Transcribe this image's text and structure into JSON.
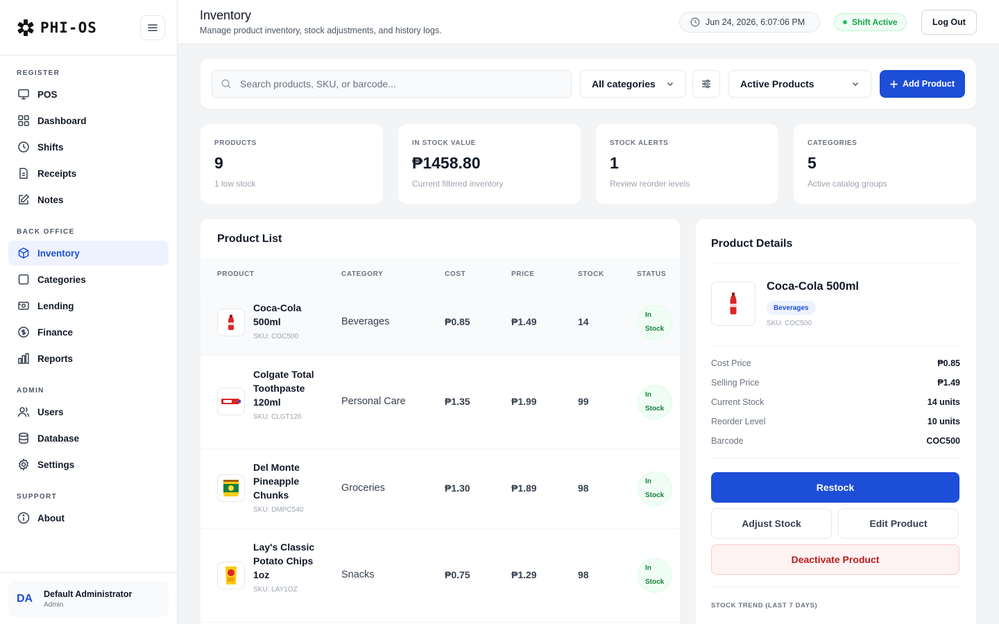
{
  "sidebar": {
    "brand": "PHI-OS",
    "sections": [
      {
        "title": "REGISTER",
        "items": [
          "POS",
          "Dashboard",
          "Shifts",
          "Receipts",
          "Notes"
        ]
      },
      {
        "title": "BACK OFFICE",
        "items": [
          "Inventory",
          "Categories",
          "Lending",
          "Finance",
          "Reports"
        ]
      },
      {
        "title": "ADMIN",
        "items": [
          "Users",
          "Database",
          "Settings"
        ]
      },
      {
        "title": "SUPPORT",
        "items": [
          "About"
        ]
      }
    ],
    "active_item": "Inventory",
    "user": {
      "initials": "DA",
      "name": "Default Administrator",
      "role": "Admin"
    }
  },
  "header": {
    "title": "Inventory",
    "subtitle": "Manage product inventory, stock adjustments, and history logs.",
    "datetime": "Jun 24, 2026, 6:07:06 PM",
    "shift_status": "Shift Active",
    "logout_label": "Log Out"
  },
  "filters": {
    "search_placeholder": "Search products, SKU, or barcode...",
    "category_select": "All categories",
    "status_select": "Active Products",
    "add_label": "Add Product"
  },
  "stats": [
    {
      "label": "PRODUCTS",
      "value": "9",
      "note": "1 low stock"
    },
    {
      "label": "IN STOCK VALUE",
      "value": "₱1458.80",
      "note": "Current filtered inventory"
    },
    {
      "label": "STOCK ALERTS",
      "value": "1",
      "note": "Review reorder levels"
    },
    {
      "label": "CATEGORIES",
      "value": "5",
      "note": "Active catalog groups"
    }
  ],
  "product_list": {
    "title": "Product List",
    "columns": [
      "PRODUCT",
      "CATEGORY",
      "COST",
      "PRICE",
      "STOCK",
      "STATUS"
    ],
    "rows": [
      {
        "name": "Coca-Cola 500ml",
        "sku": "SKU: COC500",
        "category": "Beverages",
        "cost": "₱0.85",
        "price": "₱1.49",
        "stock": "14",
        "status_line1": "In",
        "status_line2": "Stock",
        "thumb": "cola-bottle-icon"
      },
      {
        "name": "Colgate Total Toothpaste 120ml",
        "sku": "SKU: CLGT120",
        "category": "Personal Care",
        "cost": "₱1.35",
        "price": "₱1.99",
        "stock": "99",
        "status_line1": "In",
        "status_line2": "Stock",
        "thumb": "toothpaste-icon"
      },
      {
        "name": "Del Monte Pineapple Chunks",
        "sku": "SKU: DMPC540",
        "category": "Groceries",
        "cost": "₱1.30",
        "price": "₱1.89",
        "stock": "98",
        "status_line1": "In",
        "status_line2": "Stock",
        "thumb": "canned-fruit-icon"
      },
      {
        "name": "Lay's Classic Potato Chips 1oz",
        "sku": "SKU: LAY1OZ",
        "category": "Snacks",
        "cost": "₱0.75",
        "price": "₱1.29",
        "stock": "98",
        "status_line1": "In",
        "status_line2": "Stock",
        "thumb": "chips-bag-icon"
      }
    ]
  },
  "details": {
    "title": "Product Details",
    "name": "Coca-Cola 500ml",
    "category": "Beverages",
    "sku": "SKU: COC500",
    "fields": [
      {
        "label": "Cost Price",
        "value": "₱0.85"
      },
      {
        "label": "Selling Price",
        "value": "₱1.49"
      },
      {
        "label": "Current Stock",
        "value": "14 units"
      },
      {
        "label": "Reorder Level",
        "value": "10 units"
      },
      {
        "label": "Barcode",
        "value": "COC500"
      }
    ],
    "restock_label": "Restock",
    "adjust_label": "Adjust Stock",
    "edit_label": "Edit Product",
    "deactivate_label": "Deactivate Product",
    "trend_label": "STOCK TREND (LAST 7 DAYS)"
  },
  "colors": {
    "accent": "#1d4ed8",
    "success": "#16a34a",
    "danger": "#b91c1c"
  }
}
